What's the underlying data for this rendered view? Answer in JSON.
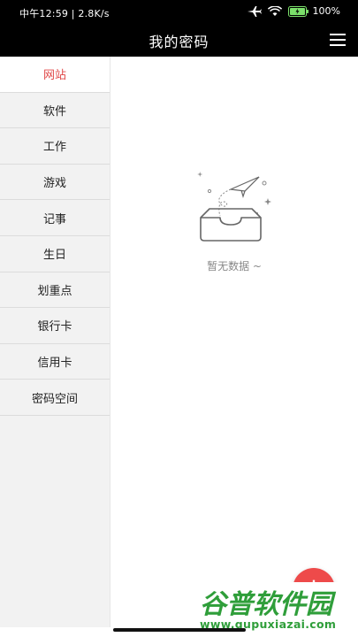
{
  "status_bar": {
    "time_speed": "中午12:59 | 2.8K/s",
    "battery": "100%"
  },
  "header": {
    "title": "我的密码"
  },
  "sidebar": {
    "items": [
      {
        "label": "网站",
        "active": true
      },
      {
        "label": "软件"
      },
      {
        "label": "工作"
      },
      {
        "label": "游戏"
      },
      {
        "label": "记事"
      },
      {
        "label": "生日"
      },
      {
        "label": "划重点"
      },
      {
        "label": "银行卡"
      },
      {
        "label": "信用卡"
      },
      {
        "label": "密码空间"
      }
    ]
  },
  "empty_state": {
    "text": "暂无数据 ~"
  },
  "fab": {
    "label": "+"
  },
  "watermark": {
    "title": "谷普软件园",
    "url": "www.gupuxiazai.com"
  },
  "colors": {
    "accent": "#e04848",
    "fab": "#ee4a4a",
    "watermark": "#2f9e3a"
  }
}
